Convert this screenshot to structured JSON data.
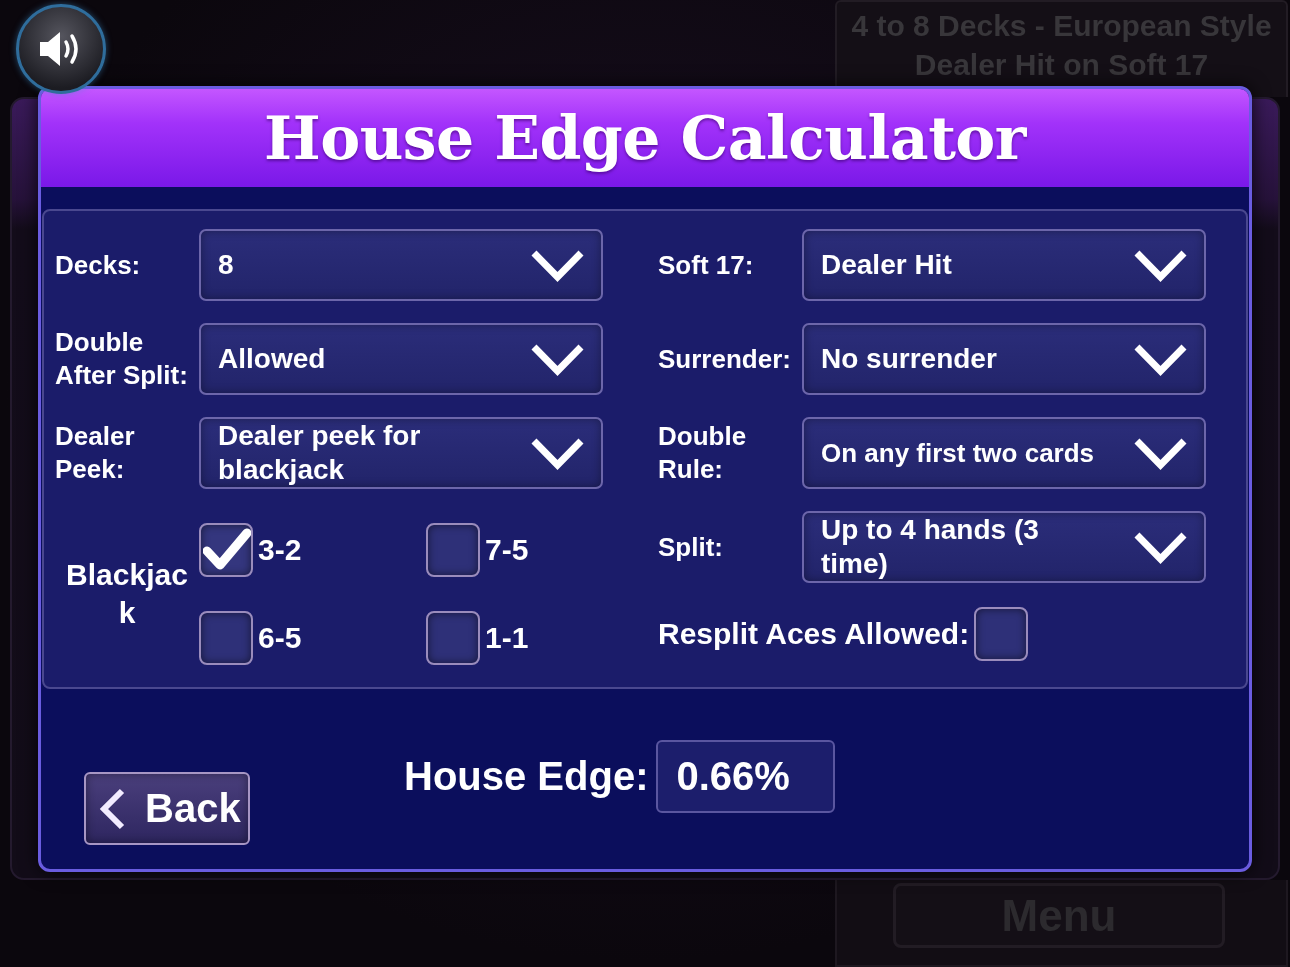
{
  "info_panel": {
    "lines": [
      "4 to 8 Decks - European Style",
      "Dealer Hit on Soft 17"
    ]
  },
  "dialog": {
    "title": "House Edge Calculator",
    "left_selects": [
      {
        "label": "Decks:",
        "value": "8"
      },
      {
        "label": "Double After Split:",
        "value": "Allowed"
      },
      {
        "label": "Dealer Peek:",
        "value": "Dealer peek for blackjack"
      }
    ],
    "payout": {
      "label": "Blackjack",
      "options": [
        {
          "label": "3-2",
          "checked": true
        },
        {
          "label": "7-5",
          "checked": false
        },
        {
          "label": "6-5",
          "checked": false
        },
        {
          "label": "1-1",
          "checked": false
        }
      ]
    },
    "right_selects": [
      {
        "label": "Soft 17:",
        "value": "Dealer Hit"
      },
      {
        "label": "Surrender:",
        "value": "No surrender"
      },
      {
        "label": "Double Rule:",
        "value": "On any first two cards"
      },
      {
        "label": "Split:",
        "value": "Up to 4 hands (3 time)"
      }
    ],
    "resplit_aces": {
      "label": "Resplit Aces Allowed:",
      "checked": false
    },
    "house_edge": {
      "label": "House Edge:",
      "value": "0.66%"
    },
    "back_button": {
      "label": "Back"
    }
  },
  "menu_button": {
    "label": "Menu"
  }
}
